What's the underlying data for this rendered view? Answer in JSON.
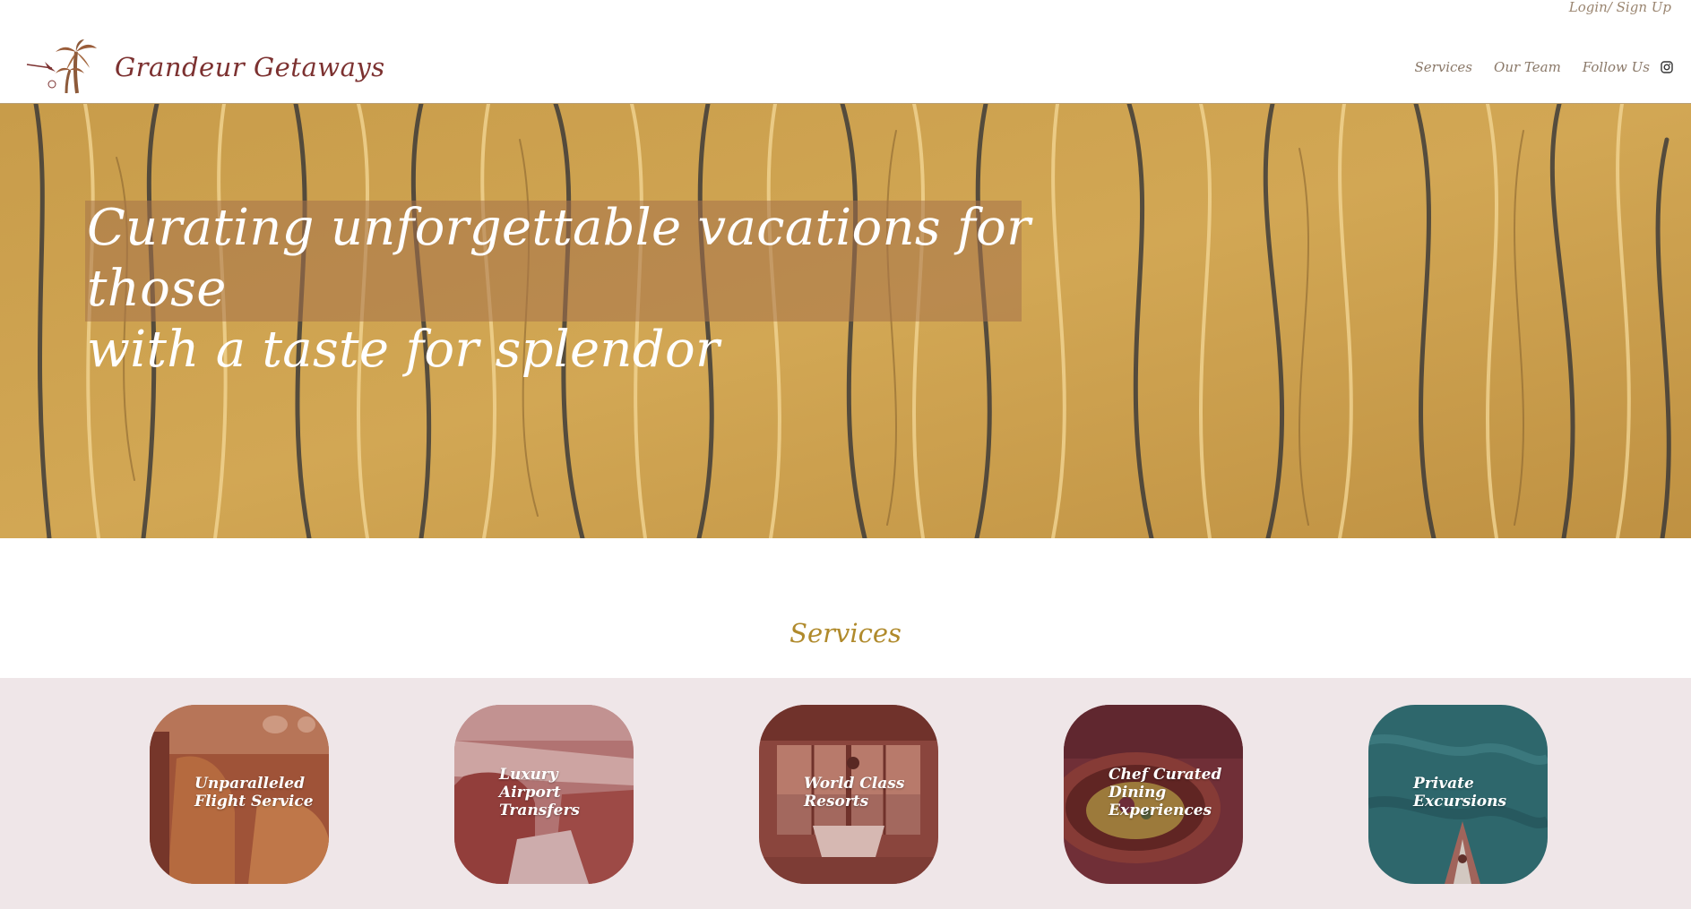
{
  "top_bar": {
    "login_label": "Login/ Sign Up"
  },
  "header": {
    "brand": "Grandeur Getaways",
    "nav": [
      {
        "label": "Services"
      },
      {
        "label": "Our Team"
      },
      {
        "label": "Follow Us"
      }
    ],
    "social_icon": "instagram-icon"
  },
  "hero": {
    "line1": "Curating unforgettable vacations for those",
    "line2": "with a taste for splendor"
  },
  "services": {
    "heading": "Services",
    "cards": [
      {
        "label": "Unparalleled\nFlight Service"
      },
      {
        "label": "Luxury\nAirport\nTransfers"
      },
      {
        "label": "World Class\nResorts"
      },
      {
        "label": "Chef Curated\nDining\nExperiences"
      },
      {
        "label": "Private\nExcursions"
      }
    ]
  },
  "colors": {
    "brand": "#7c3130",
    "accent_gold": "#b08a2c",
    "nav_text": "#8a7868",
    "services_band": "#efe6e8"
  }
}
